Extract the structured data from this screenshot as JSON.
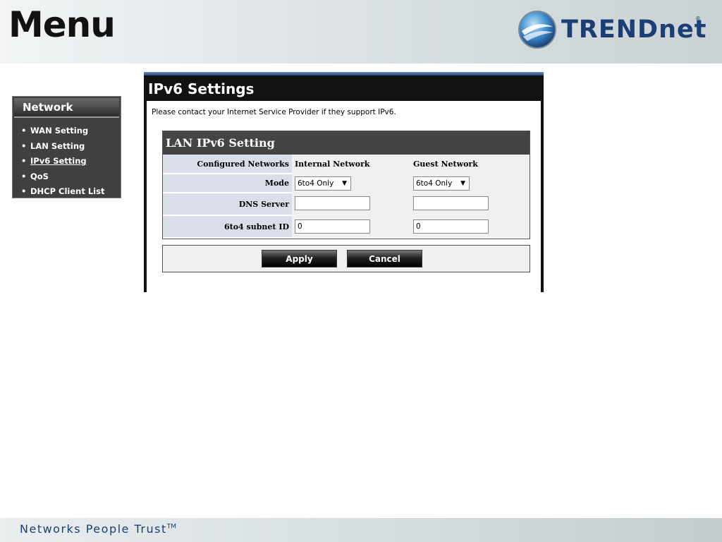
{
  "slide": {
    "title": "Menu",
    "logo_text": "TRENDnet",
    "logo_registered": "®",
    "tagline": "Networks People Trust",
    "tagline_tm": "TM"
  },
  "sidebar": {
    "title": "Network",
    "items": [
      {
        "label": "WAN Setting",
        "active": false
      },
      {
        "label": "LAN Setting",
        "active": false
      },
      {
        "label": "IPv6 Setting",
        "active": true
      },
      {
        "label": "QoS",
        "active": false
      },
      {
        "label": "DHCP Client List",
        "active": false
      }
    ]
  },
  "panel": {
    "title": "IPv6 Settings",
    "note": "Please contact your Internet Service Provider if they support IPv6.",
    "section_title": "LAN IPv6 Setting",
    "headers": {
      "label": "Configured Networks",
      "internal": "Internal Network",
      "guest": "Guest Network"
    },
    "rows": {
      "mode_label": "Mode",
      "mode_internal": "6to4 Only",
      "mode_guest": "6to4 Only",
      "dns_label": "DNS Server",
      "dns_internal": "",
      "dns_guest": "",
      "subnet_label": "6to4 subnet ID",
      "subnet_internal": "0",
      "subnet_guest": "0"
    },
    "apply_label": "Apply",
    "cancel_label": "Cancel"
  },
  "colors": {
    "brand_blue": "#1b3f74",
    "panel_dark": "#111111",
    "label_cell": "#d9dee9"
  }
}
